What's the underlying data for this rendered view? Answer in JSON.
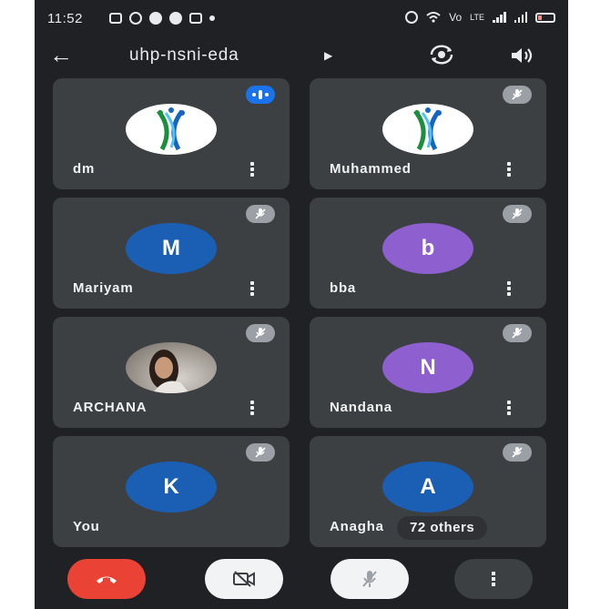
{
  "status_bar": {
    "time": "11:52",
    "notification_icons": [
      "cast-icon",
      "b-icon",
      "messages-icon",
      "jio-icon",
      "instagram-icon",
      "dot-icon"
    ],
    "right_icons": [
      "alarm-icon",
      "wifi-icon",
      "volte-icon",
      "lte-icon",
      "signal-icon",
      "signal-icon",
      "battery-icon"
    ],
    "volte": "Vo",
    "lte": "LTE"
  },
  "header": {
    "meeting_code": "uhp-nsni-eda",
    "back_icon": "arrow-left-icon",
    "caret_icon": "caret-right-icon",
    "camera_switch_icon": "camera-switch-icon",
    "speaker_icon": "speaker-icon"
  },
  "participants": [
    {
      "name": "dm",
      "avatar_type": "logo",
      "status": "speaking"
    },
    {
      "name": "Muhammed",
      "avatar_type": "logo",
      "status": "muted"
    },
    {
      "name": "Mariyam",
      "avatar_type": "letter",
      "letter": "M",
      "color": "#1a5fb4",
      "status": "muted"
    },
    {
      "name": "bba",
      "avatar_type": "letter",
      "letter": "b",
      "color": "#8e5fcf",
      "status": "muted"
    },
    {
      "name": "ARCHANA",
      "avatar_type": "photo",
      "status": "muted"
    },
    {
      "name": "Nandana",
      "avatar_type": "letter",
      "letter": "N",
      "color": "#8e5fcf",
      "status": "muted"
    },
    {
      "name": "You",
      "avatar_type": "letter",
      "letter": "K",
      "color": "#1a5fb4",
      "status": "muted"
    },
    {
      "name": "Anagha",
      "avatar_type": "letter",
      "letter": "A",
      "color": "#1a5fb4",
      "status": "muted"
    }
  ],
  "others_chip": "72 others",
  "controls": {
    "end_call_icon": "end-call-icon",
    "camera_off_icon": "camera-off-icon",
    "mic_off_icon": "mic-off-icon",
    "more_icon": "more-options-icon"
  },
  "colors": {
    "background": "#202124",
    "tile": "#3c4043",
    "end_call": "#ea4335",
    "speaking": "#1a73e8",
    "muted_badge": "#9aa0a6"
  }
}
